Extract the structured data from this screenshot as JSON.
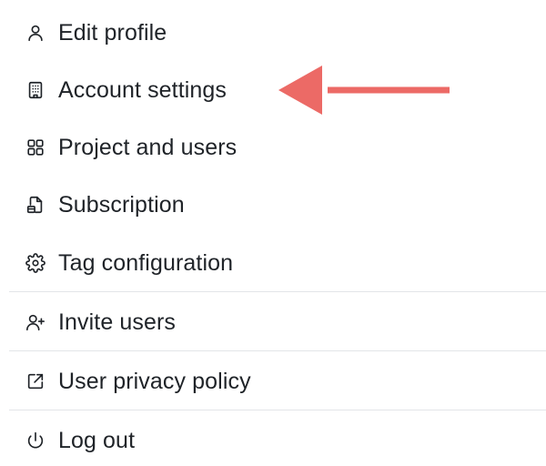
{
  "menu": {
    "items": [
      {
        "label": "Edit profile",
        "icon": "user-icon"
      },
      {
        "label": "Account settings",
        "icon": "building-icon"
      },
      {
        "label": "Project and users",
        "icon": "grid-icon"
      },
      {
        "label": "Subscription",
        "icon": "file-subscription-icon"
      },
      {
        "label": "Tag configuration",
        "icon": "gear-icon"
      },
      {
        "label": "Invite users",
        "icon": "user-plus-icon"
      },
      {
        "label": "User privacy policy",
        "icon": "external-link-icon"
      },
      {
        "label": "Log out",
        "icon": "power-icon"
      }
    ]
  },
  "annotation": {
    "arrow_color": "#ec6a66",
    "points_to": "Account settings"
  },
  "colors": {
    "text": "#1f2328",
    "divider": "#e3e5e8",
    "background": "#ffffff"
  }
}
